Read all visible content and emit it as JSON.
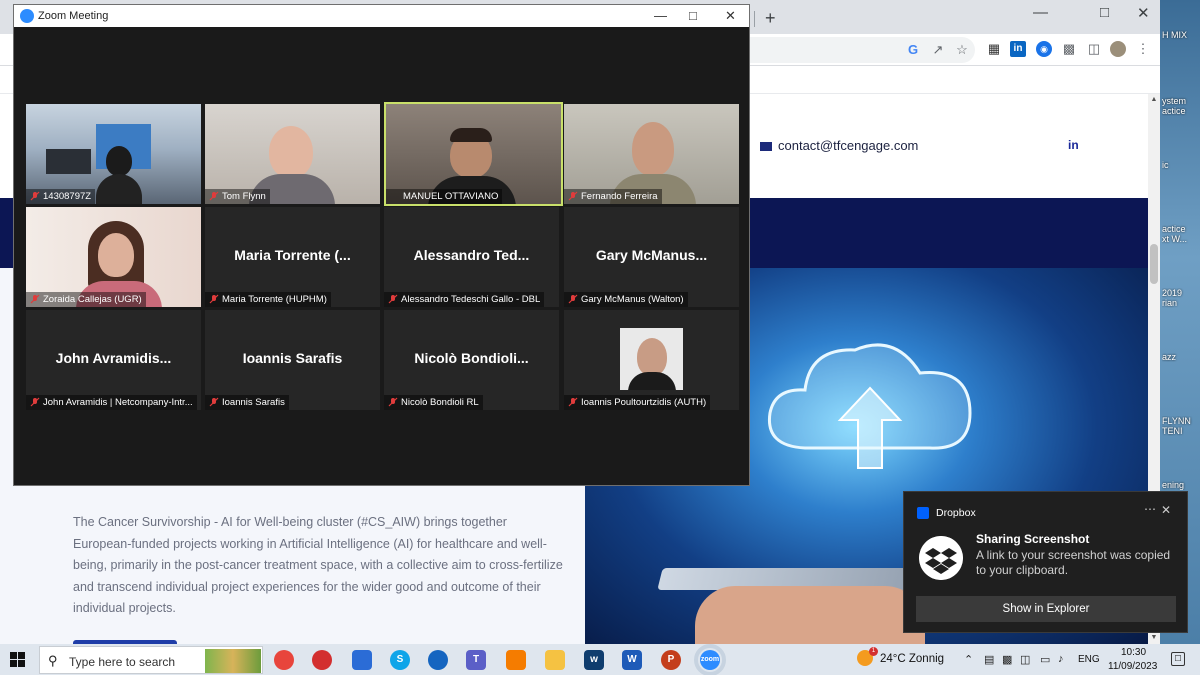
{
  "desktop": {
    "items": [
      "H MIX",
      "ystem\nactice",
      "ic",
      "actice\nxt W...",
      "2019\nrian",
      "azz",
      "FLYNN\nTENI",
      "ening"
    ]
  },
  "browser": {
    "new_tab": "+",
    "toolbar_icons": [
      "google-icon",
      "share-icon",
      "star-icon",
      "extension-icon-1",
      "linkedin-extension-icon",
      "extension-icon-3",
      "puzzle-icon",
      "side-panel-icon",
      "profile-avatar",
      "menu-icon"
    ]
  },
  "page": {
    "contact_email": "contact@tfcengage.com",
    "linkedin_label": "in",
    "description": "The Cancer Survivorship - AI for Well-being cluster (#CS_AIW) brings together European-funded projects working in Artificial Intelligence (AI) for healthcare and well-being, primarily in the post-cancer treatment space, with a collective aim to cross-fertilize and transcend individual project experiences for the wider good and outcome of their individual projects."
  },
  "zoom": {
    "title": "Zoom Meeting",
    "participants": [
      {
        "label": "14308797Z",
        "big": "",
        "video": true
      },
      {
        "label": "Tom Flynn",
        "big": "",
        "video": true
      },
      {
        "label": "MANUEL OTTAVIANO",
        "big": "",
        "video": true,
        "active": true
      },
      {
        "label": "Fernando Ferreira",
        "big": "",
        "video": true
      },
      {
        "label": "Zoraida Callejas (UGR)",
        "big": "",
        "video": true
      },
      {
        "label": "Maria Torrente (HUPHM)",
        "big": "Maria Torrente (...",
        "video": false
      },
      {
        "label": "Alessandro Tedeschi Gallo - DBL",
        "big": "Alessandro Ted...",
        "video": false
      },
      {
        "label": "Gary McManus (Walton)",
        "big": "Gary McManus...",
        "video": false
      },
      {
        "label": "John Avramidis | Netcompany-Intr...",
        "big": "John Avramidis...",
        "video": false
      },
      {
        "label": "Ioannis Sarafis",
        "big": "Ioannis Sarafis",
        "video": false
      },
      {
        "label": "Nicolò Bondioli RL",
        "big": "Nicolò Bondioli...",
        "video": false
      },
      {
        "label": "Ioannis Poultourtzidis (AUTH)",
        "big": "",
        "video": false,
        "photo": true
      }
    ]
  },
  "toast": {
    "app": "Dropbox",
    "title": "Sharing Screenshot",
    "body": "A link to your screenshot was copied to your clipboard.",
    "button": "Show in Explorer"
  },
  "taskbar": {
    "search_placeholder": "Type here to search",
    "apps": [
      {
        "name": "chrome",
        "color": "#e8453c"
      },
      {
        "name": "opera",
        "color": "#d32f2f"
      },
      {
        "name": "store",
        "color": "#2b6cd6"
      },
      {
        "name": "skype",
        "color": "#0ea5e9"
      },
      {
        "name": "teamviewer",
        "color": "#1565c0"
      },
      {
        "name": "teams",
        "color": "#5b5fc7"
      },
      {
        "name": "app-orange",
        "color": "#f57c00"
      },
      {
        "name": "file-explorer",
        "color": "#f5c242"
      },
      {
        "name": "app-wave",
        "color": "#0f3d6e"
      },
      {
        "name": "word",
        "color": "#1e5bb8"
      },
      {
        "name": "powerpoint",
        "color": "#c43e1c"
      },
      {
        "name": "zoom",
        "color": "#2d8cff"
      }
    ],
    "weather_badge": "1",
    "weather": "24°C  Zonnig",
    "language": "ENG",
    "time": "10:30",
    "date": "11/09/2023"
  }
}
